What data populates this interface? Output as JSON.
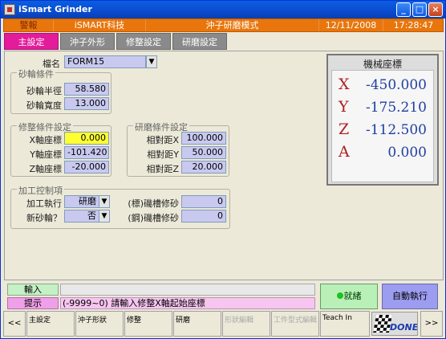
{
  "window": {
    "title": "iSmart Grinder"
  },
  "status_bar": {
    "alarm": "警報",
    "company": "iSMART科技",
    "mode": "沖子研磨模式",
    "date": "12/11/2008",
    "time": "17:28:47"
  },
  "tabs": [
    {
      "label": "主設定"
    },
    {
      "label": "沖子外形"
    },
    {
      "label": "修整設定"
    },
    {
      "label": "研磨設定"
    }
  ],
  "file": {
    "label": "檔名",
    "value": "FORM15"
  },
  "wheel_group": {
    "title": "砂輪條件",
    "radius_label": "砂輪半徑",
    "radius_value": "58.580",
    "width_label": "砂輪寬度",
    "width_value": "13.000"
  },
  "dress_group": {
    "title": "修整條件設定",
    "x_label": "X軸座標",
    "x_value": "0.000",
    "y_label": "Y軸座標",
    "y_value": "-101.420",
    "z_label": "Z軸座標",
    "z_value": "-20.000"
  },
  "grind_group": {
    "title": "研磨條件設定",
    "x_label": "相對距X",
    "x_value": "100.000",
    "y_label": "相對距Y",
    "y_value": "50.000",
    "z_label": "相對距Z",
    "z_value": "20.000"
  },
  "control_group": {
    "title": "加工控制項",
    "exec_label": "加工執行",
    "exec_value": "研磨",
    "newwheel_label": "新砂輪？",
    "newwheel_value": "否",
    "comp1_label": "(標)磯槽修砂",
    "comp1_value": "0",
    "comp2_label": "(鋼)磯槽修砂",
    "comp2_value": "0"
  },
  "machine_coords": {
    "title": "機械座標",
    "axes": [
      {
        "name": "X",
        "value": "-450.000"
      },
      {
        "name": "Y",
        "value": "-175.210"
      },
      {
        "name": "Z",
        "value": "-112.500"
      },
      {
        "name": "A",
        "value": "0.000"
      }
    ]
  },
  "input": {
    "label": "輸入",
    "value": ""
  },
  "hint": {
    "label": "提示",
    "text": "(-9999~0) 請輸入修整X軸起始座標"
  },
  "buttons": {
    "ready": "就緒",
    "auto": "自動執行"
  },
  "function_keys": [
    {
      "label": "<<"
    },
    {
      "label": "主設定"
    },
    {
      "label": "沖子形狀"
    },
    {
      "label": "修整"
    },
    {
      "label": "研磨"
    },
    {
      "label": "形狀編輯"
    },
    {
      "label": "工件型式編輯"
    },
    {
      "label": "Teach In"
    },
    {
      "label": ">>"
    }
  ],
  "logo": {
    "text": "DONE"
  },
  "colors": {
    "status_bar": "#e8760c",
    "active_tab": "#e21c9a",
    "field": "#c9c9f0",
    "ready": "#b8f0b8",
    "auto": "#9c9cf0"
  }
}
